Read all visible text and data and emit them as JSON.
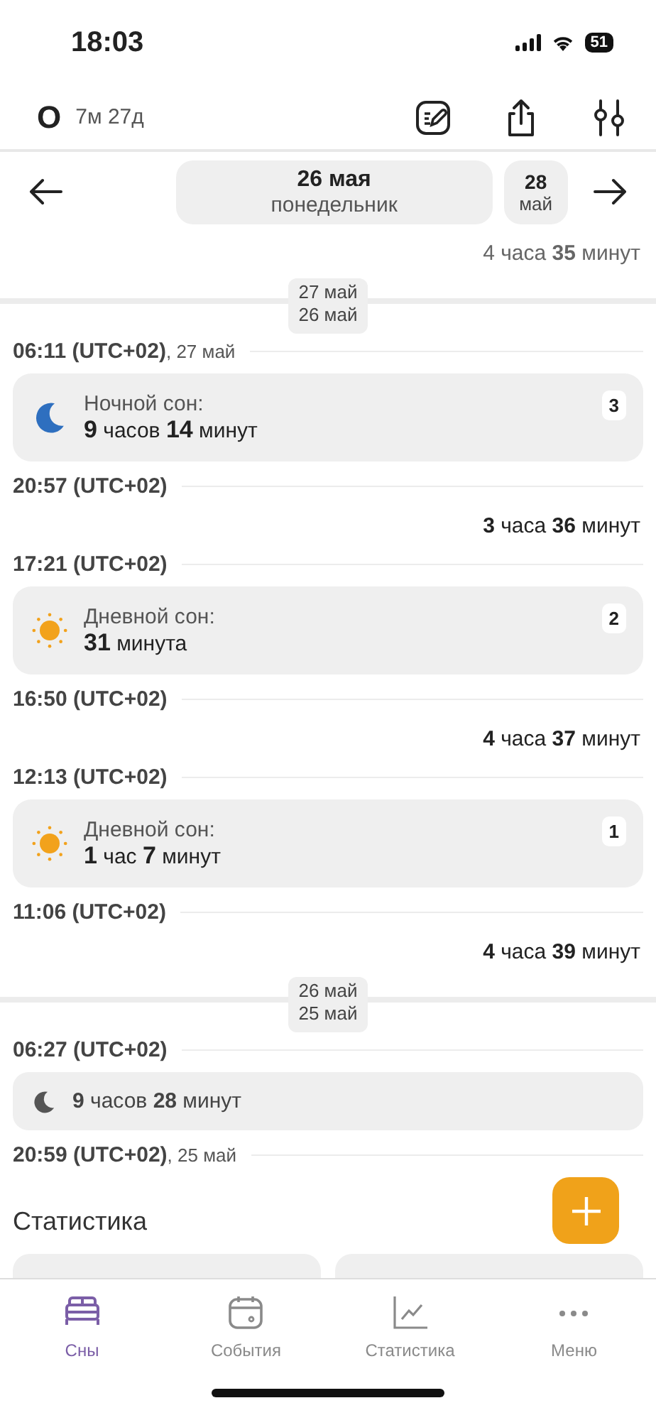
{
  "status_bar": {
    "time": "18:03",
    "battery": "51"
  },
  "header": {
    "avatar_letter": "О",
    "age": "7м 27д"
  },
  "date_nav": {
    "date": "26 мая",
    "weekday": "понедельник",
    "next_day": "28",
    "next_month": "май"
  },
  "timeline": [
    {
      "kind": "gap",
      "text": "4 часа **35** минут",
      "muted": true
    },
    {
      "kind": "break",
      "upper": "27 май",
      "lower": "26 май"
    },
    {
      "kind": "time",
      "time": "06:11 (UTC+02)",
      "date": ", 27 май"
    },
    {
      "kind": "night_sleep",
      "label": "Ночной сон:",
      "duration": "**9** часов **14** минут",
      "count": "3"
    },
    {
      "kind": "time",
      "time": "20:57 (UTC+02)"
    },
    {
      "kind": "gap",
      "text": "**3** часа **36** минут",
      "muted": false
    },
    {
      "kind": "time",
      "time": "17:21 (UTC+02)"
    },
    {
      "kind": "day_sleep",
      "label": "Дневной сон:",
      "duration": "**31** минута",
      "count": "2"
    },
    {
      "kind": "time",
      "time": "16:50 (UTC+02)"
    },
    {
      "kind": "gap",
      "text": "**4** часа **37** минут",
      "muted": false
    },
    {
      "kind": "time",
      "time": "12:13 (UTC+02)"
    },
    {
      "kind": "day_sleep",
      "label": "Дневной сон:",
      "duration": "**1** час **7** минут",
      "count": "1"
    },
    {
      "kind": "time",
      "time": "11:06 (UTC+02)"
    },
    {
      "kind": "gap",
      "text": "**4** часа **39** минут",
      "muted": false
    },
    {
      "kind": "break",
      "upper": "26 май",
      "lower": "25 май"
    },
    {
      "kind": "time",
      "time": "06:27 (UTC+02)"
    },
    {
      "kind": "compact_night_sleep",
      "duration": "**9** часов **28** минут"
    },
    {
      "kind": "time",
      "time": "20:59 (UTC+02)",
      "date": ", 25 май"
    }
  ],
  "statistics": {
    "title": "Статистика"
  },
  "tab_bar": [
    {
      "label": "Сны",
      "selected": true
    },
    {
      "label": "События",
      "selected": false
    },
    {
      "label": "Статистика",
      "selected": false
    },
    {
      "label": "Меню",
      "selected": false
    }
  ]
}
